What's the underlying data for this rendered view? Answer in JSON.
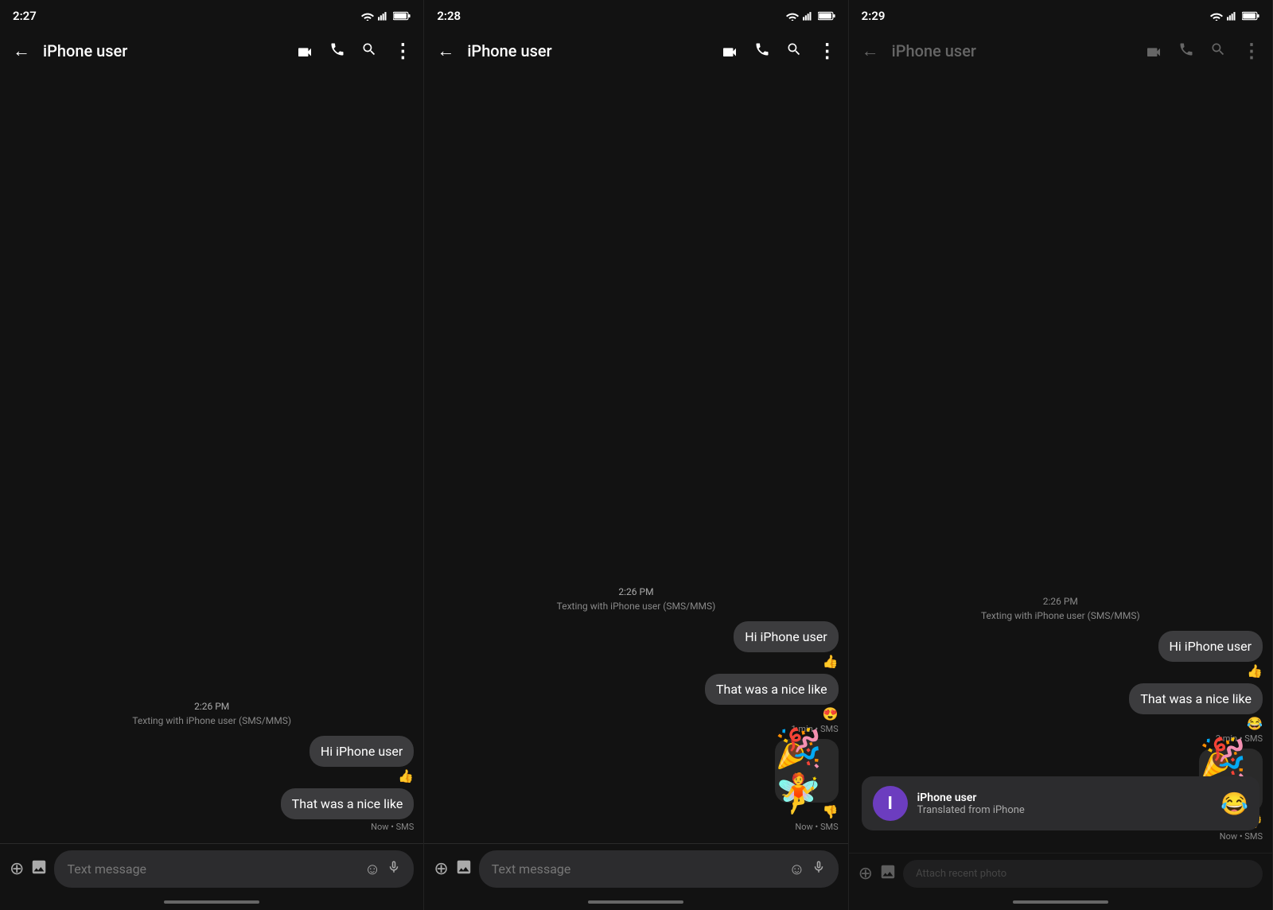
{
  "panels": [
    {
      "id": "panel1",
      "time": "2:27",
      "contact": "iPhone user",
      "timeDivider": "2:26 PM",
      "subDivider": "Texting with iPhone user (SMS/MMS)",
      "messages": [
        {
          "text": "Hi iPhone user",
          "reaction": "👍",
          "meta": ""
        },
        {
          "text": "That was a nice like",
          "reaction": "",
          "meta": "Now • SMS"
        }
      ],
      "inputPlaceholder": "Text message"
    },
    {
      "id": "panel2",
      "time": "2:28",
      "contact": "iPhone user",
      "timeDivider": "2:26 PM",
      "subDivider": "Texting with iPhone user (SMS/MMS)",
      "messages": [
        {
          "text": "Hi iPhone user",
          "reaction": "👍",
          "meta": ""
        },
        {
          "text": "That was a nice like",
          "reaction": "😍",
          "meta": "1 min • SMS"
        },
        {
          "text": "sticker",
          "reaction": "👎",
          "meta": "Now • SMS",
          "isSticker": true,
          "stickerEmoji": "🎉🧚"
        }
      ],
      "inputPlaceholder": "Text message"
    },
    {
      "id": "panel3",
      "time": "2:29",
      "contact": "iPhone user",
      "timeDivider": "2:26 PM",
      "subDivider": "Texting with iPhone user (SMS/MMS)",
      "messages": [
        {
          "text": "Hi iPhone user",
          "reaction": "👍",
          "meta": ""
        },
        {
          "text": "That was a nice like",
          "reaction": "😂",
          "meta": "2 min • SMS"
        },
        {
          "text": "sticker",
          "reaction": "👎",
          "meta": "Now • SMS",
          "isSticker": true,
          "stickerEmoji": "🎉🧚"
        }
      ],
      "notification": {
        "avatar": "I",
        "title": "iPhone user",
        "subtitle": "Translated from iPhone",
        "emoji": "😂"
      },
      "inputPlaceholder": "Attach recent photo"
    }
  ],
  "icons": {
    "back": "←",
    "video": "📹",
    "phone": "📞",
    "search": "🔍",
    "more": "⋮",
    "add": "⊕",
    "gallery": "▣",
    "emoji": "☺",
    "mic": "🎤"
  }
}
